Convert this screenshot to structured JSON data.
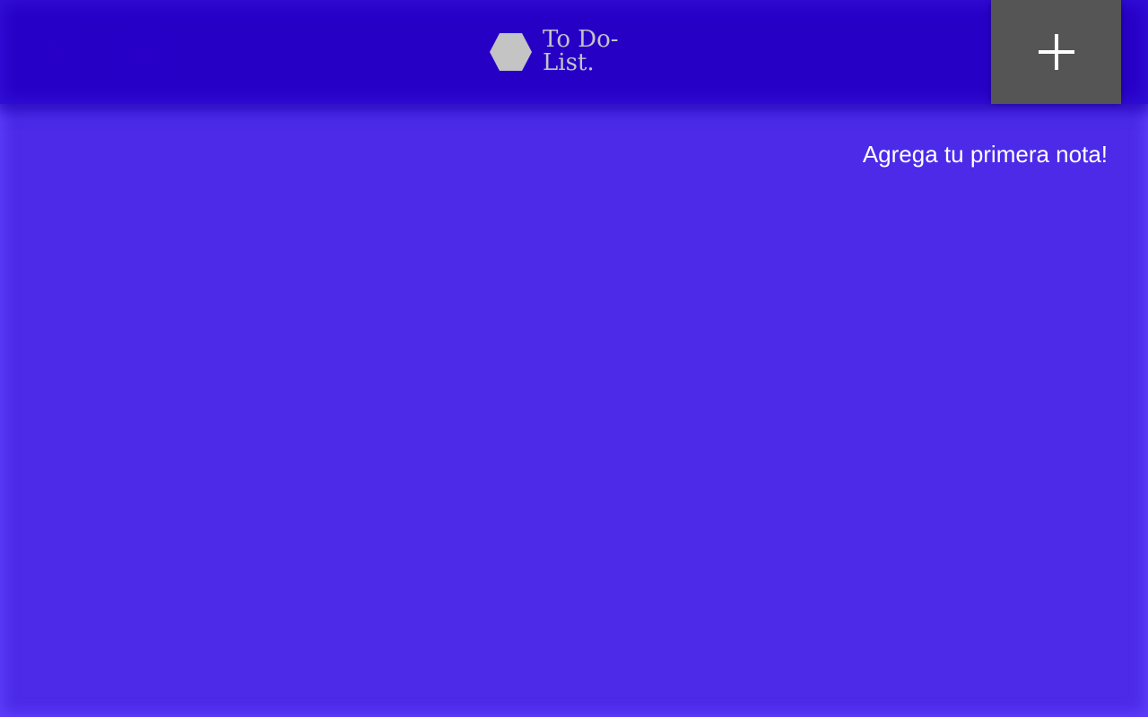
{
  "header": {
    "title": "To Do-List.",
    "logo_icon": "hexagon-icon",
    "add_button_icon": "plus-icon"
  },
  "main": {
    "empty_message": "Agrega tu primera nota!"
  },
  "colors": {
    "background": "#4c2ae8",
    "header": "#2700c6",
    "add_button": "#555555",
    "logo": "#c4c4c4",
    "text": "#ffffff"
  }
}
